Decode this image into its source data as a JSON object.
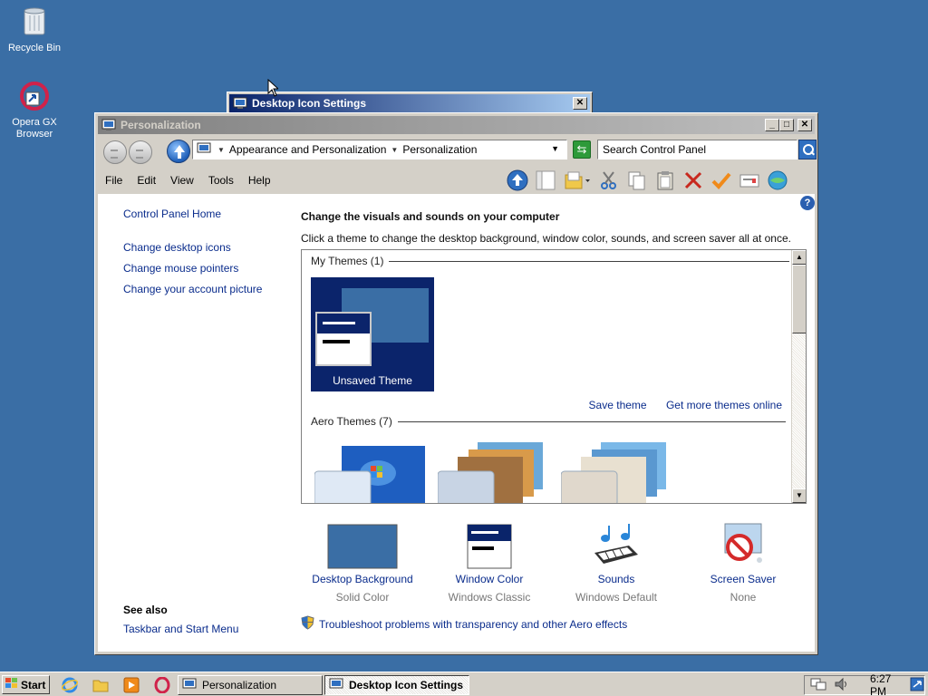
{
  "desktop": {
    "icons": [
      {
        "label": "Recycle Bin",
        "icon": "recycle-bin-icon"
      },
      {
        "label": "Opera GX Browser",
        "icon": "opera-gx-icon"
      }
    ]
  },
  "background_window": {
    "title": "Desktop Icon Settings"
  },
  "window": {
    "title": "Personalization",
    "breadcrumb": [
      "Appearance and Personalization",
      "Personalization"
    ],
    "search": {
      "placeholder": "Search Control Panel"
    },
    "menu": [
      "File",
      "Edit",
      "View",
      "Tools",
      "Help"
    ],
    "toolbar_icons": [
      "up-folder-icon",
      "folders-pane-icon",
      "folder-view-icon",
      "cut-icon",
      "copy-icon",
      "paste-icon",
      "delete-icon",
      "check-icon",
      "properties-icon",
      "network-icon"
    ]
  },
  "sidebar": {
    "home": "Control Panel Home",
    "links": [
      "Change desktop icons",
      "Change mouse pointers",
      "Change your account picture"
    ],
    "see_also": {
      "heading": "See also",
      "links": [
        "Taskbar and Start Menu"
      ]
    }
  },
  "main": {
    "heading": "Change the visuals and sounds on your computer",
    "subheading": "Click a theme to change the desktop background, window color, sounds, and screen saver all at once.",
    "my_themes": {
      "label": "My Themes (1)",
      "themes": [
        {
          "name": "Unsaved Theme"
        }
      ],
      "save_link": "Save theme",
      "more_link": "Get more themes online"
    },
    "aero_themes": {
      "label": "Aero Themes (7)"
    },
    "settings": [
      {
        "label": "Desktop Background",
        "value": "Solid Color",
        "icon": "desktop-background-icon"
      },
      {
        "label": "Window Color",
        "value": "Windows Classic",
        "icon": "window-color-icon"
      },
      {
        "label": "Sounds",
        "value": "Windows Default",
        "icon": "sounds-icon"
      },
      {
        "label": "Screen Saver",
        "value": "None",
        "icon": "screen-saver-icon"
      }
    ],
    "troubleshoot": "Troubleshoot problems with transparency and other Aero effects"
  },
  "taskbar": {
    "start_label": "Start",
    "quick_launch": [
      "internet-explorer-icon",
      "windows-explorer-icon",
      "media-player-icon",
      "opera-icon"
    ],
    "tasks": [
      {
        "label": "Personalization",
        "active": false
      },
      {
        "label": "Desktop Icon Settings",
        "active": true
      }
    ],
    "clock": "6:27 PM"
  },
  "colors": {
    "desktop": "#3a6ea5",
    "link": "#0a2c8c",
    "classic_face": "#d4d0c8",
    "active_title": "#0a246a"
  }
}
